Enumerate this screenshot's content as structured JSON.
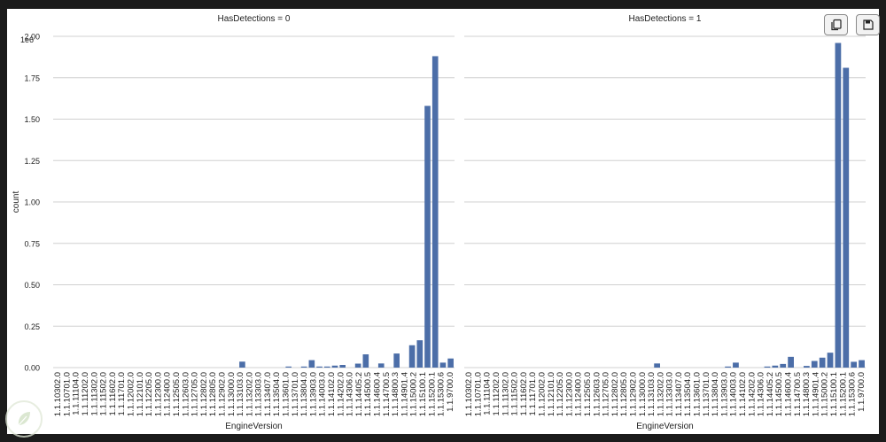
{
  "toolbar": {
    "copy_icon": "copy-icon",
    "save_icon": "save-icon"
  },
  "logo_icon": "leaf-icon",
  "chart_data": {
    "type": "bar",
    "layout": "faceted",
    "color": "#4c6ea8",
    "ylabel": "count",
    "y_offset_label": "1e6",
    "ylim": [
      0,
      2.0
    ],
    "yticks": [
      "0.00",
      "0.25",
      "0.50",
      "0.75",
      "1.00",
      "1.25",
      "1.50",
      "1.75",
      "2.00"
    ],
    "ytick_values": [
      0,
      0.25,
      0.5,
      0.75,
      1.0,
      1.25,
      1.5,
      1.75,
      2.0
    ],
    "grid": "horizontal",
    "facets": [
      {
        "title": "HasDetections = 0",
        "xlabel": "EngineVersion",
        "xtick_labels": [
          "1.1.10302.0",
          "1.1.10701.0",
          "1.1.11104.0",
          "1.1.11202.0",
          "1.1.11302.0",
          "1.1.11502.0",
          "1.1.11602.0",
          "1.1.11701.0",
          "1.1.12002.0",
          "1.1.12101.0",
          "1.1.12205.0",
          "1.1.12300.0",
          "1.1.12400.0",
          "1.1.12505.0",
          "1.1.12603.0",
          "1.1.12705.0",
          "1.1.12802.0",
          "1.1.12805.0",
          "1.1.12902.0",
          "1.1.13000.0",
          "1.1.13103.0",
          "1.1.13202.0",
          "1.1.13303.0",
          "1.1.13407.0",
          "1.1.13504.0",
          "1.1.13601.0",
          "1.1.13701.0",
          "1.1.13804.0",
          "1.1.13903.0",
          "1.1.14003.0",
          "1.1.14102.0",
          "1.1.14202.0",
          "1.1.14306.0",
          "1.1.14405.2",
          "1.1.14500.5",
          "1.1.14600.4",
          "1.1.14700.5",
          "1.1.14800.3",
          "1.1.14901.4",
          "1.1.15000.2",
          "1.1.15100.1",
          "1.1.15200.1",
          "1.1.15300.6",
          "1.1.9700.0"
        ],
        "values": [
          0,
          0,
          0,
          0,
          0,
          0,
          0,
          0,
          0,
          0,
          0,
          0,
          0,
          0,
          0,
          0,
          0,
          0,
          0,
          0,
          0,
          0,
          0,
          0,
          0.036,
          0,
          0,
          0,
          0,
          0,
          0.004,
          0,
          0.001,
          0.045,
          0.004,
          0.002,
          0.012,
          0.016,
          0,
          0.024,
          0.08,
          0,
          0.025,
          0,
          0.085,
          0,
          0.135,
          0.165,
          1.58,
          1.88,
          0.03,
          0.055
        ]
      },
      {
        "title": "HasDetections = 1",
        "xlabel": "EngineVersion",
        "xtick_labels": [
          "1.1.10302.0",
          "1.1.10701.0",
          "1.1.11104.0",
          "1.1.11202.0",
          "1.1.11302.0",
          "1.1.11502.0",
          "1.1.11602.0",
          "1.1.11701.0",
          "1.1.12002.0",
          "1.1.12101.0",
          "1.1.12205.0",
          "1.1.12300.0",
          "1.1.12400.0",
          "1.1.12505.0",
          "1.1.12603.0",
          "1.1.12705.0",
          "1.1.12802.0",
          "1.1.12805.0",
          "1.1.12902.0",
          "1.1.13000.0",
          "1.1.13103.0",
          "1.1.13202.0",
          "1.1.13303.0",
          "1.1.13407.0",
          "1.1.13504.0",
          "1.1.13601.0",
          "1.1.13701.0",
          "1.1.13804.0",
          "1.1.13903.0",
          "1.1.14003.0",
          "1.1.14102.0",
          "1.1.14202.0",
          "1.1.14306.0",
          "1.1.14405.2",
          "1.1.14500.5",
          "1.1.14600.4",
          "1.1.14700.5",
          "1.1.14800.3",
          "1.1.14901.4",
          "1.1.15000.2",
          "1.1.15100.1",
          "1.1.15200.1",
          "1.1.15300.6",
          "1.1.9700.0"
        ],
        "values": [
          0,
          0,
          0,
          0,
          0,
          0,
          0,
          0,
          0,
          0,
          0,
          0,
          0,
          0,
          0,
          0,
          0,
          0,
          0,
          0,
          0,
          0,
          0,
          0,
          0.025,
          0,
          0,
          0,
          0,
          0,
          0,
          0,
          0,
          0.002,
          0.03,
          0,
          0,
          0,
          0.004,
          0.012,
          0.022,
          0.065,
          0,
          0.01,
          0.04,
          0.06,
          0.09,
          1.96,
          1.81,
          0.035,
          0.045
        ]
      }
    ]
  }
}
